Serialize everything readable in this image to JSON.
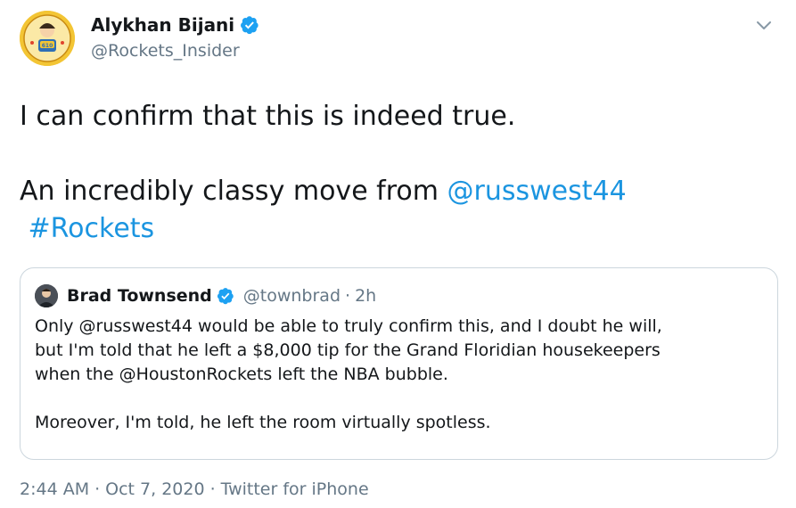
{
  "tweet": {
    "author": {
      "name": "Alykhan Bijani",
      "handle": "@Rockets_Insider",
      "avatar_icon": "charity-badge-avatar",
      "verified_icon": "verified-badge-icon"
    },
    "text_lines": [
      "I can confirm that this is indeed true."
    ],
    "second_line_prefix": "An incredibly classy move from ",
    "mention": "@russwest44",
    "hashtag": "#Rockets",
    "timestamp": "2:44 AM",
    "date": "Oct 7, 2020",
    "source": "Twitter for iPhone",
    "separator": "·"
  },
  "quoted_tweet": {
    "author": {
      "name": "Brad Townsend",
      "handle": "@townbrad",
      "time": "2h"
    },
    "lines": [
      "Only @russwest44 would be able to truly confirm this, and I doubt he will,",
      "but I'm told that he left a $8,000 tip for the Grand Floridian housekeepers",
      "when the @HoustonRockets left the NBA bubble."
    ],
    "last_line": "Moreover, I'm told, he left the room virtually spotless."
  },
  "colors": {
    "link": "#1b95e0",
    "secondary_text": "#657786",
    "verified": "#1da1f2",
    "border": "#ccd6dd"
  }
}
